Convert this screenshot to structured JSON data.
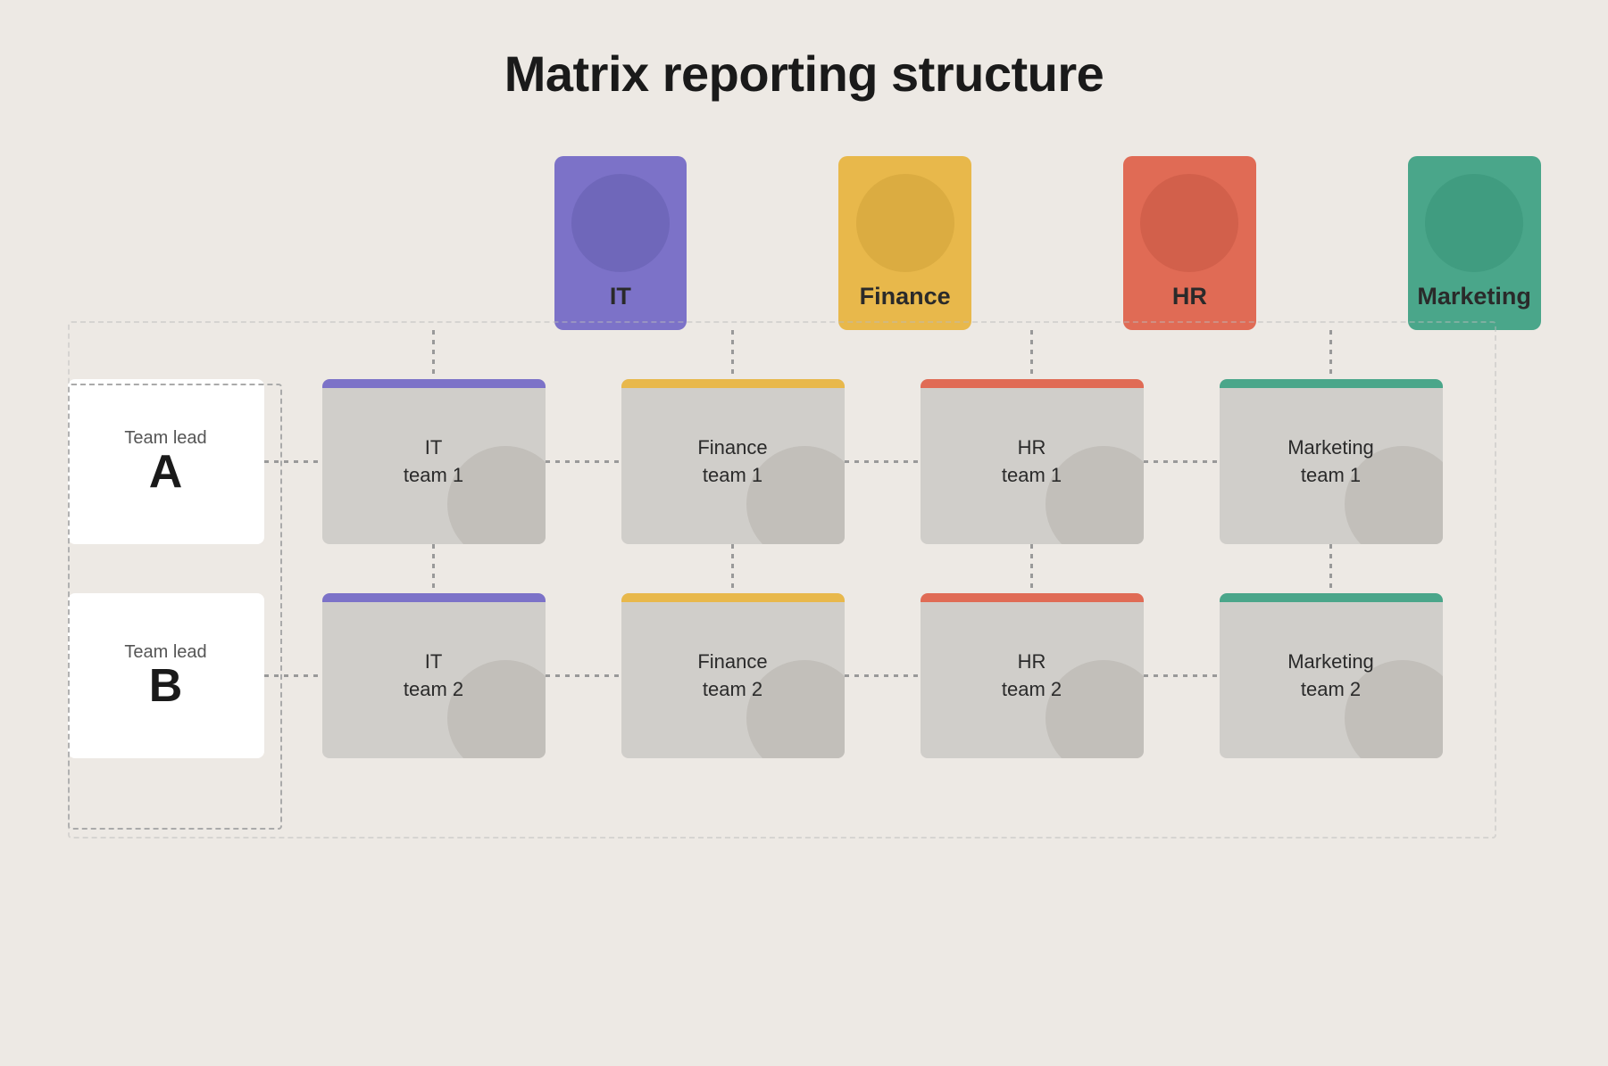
{
  "title": "Matrix reporting structure",
  "departments": [
    {
      "id": "it",
      "label": "IT",
      "colorClass": "dept-it",
      "barClass": "bar-it"
    },
    {
      "id": "finance",
      "label": "Finance",
      "colorClass": "dept-finance",
      "barClass": "bar-finance"
    },
    {
      "id": "hr",
      "label": "HR",
      "colorClass": "dept-hr",
      "barClass": "bar-hr"
    },
    {
      "id": "marketing",
      "label": "Marketing",
      "colorClass": "dept-marketing",
      "barClass": "bar-marketing"
    }
  ],
  "team_leads": [
    {
      "id": "a",
      "title": "Team lead",
      "letter": "A"
    },
    {
      "id": "b",
      "title": "Team lead",
      "letter": "B"
    }
  ],
  "teams_row1": [
    {
      "label": "IT\nteam 1",
      "line1": "IT",
      "line2": "team 1",
      "barClass": "bar-it"
    },
    {
      "label": "Finance\nteam 1",
      "line1": "Finance",
      "line2": "team 1",
      "barClass": "bar-finance"
    },
    {
      "label": "HR\nteam 1",
      "line1": "HR",
      "line2": "team 1",
      "barClass": "bar-hr"
    },
    {
      "label": "Marketing\nteam 1",
      "line1": "Marketing",
      "line2": "team 1",
      "barClass": "bar-marketing"
    }
  ],
  "teams_row2": [
    {
      "label": "IT\nteam 2",
      "line1": "IT",
      "line2": "team 2",
      "barClass": "bar-it"
    },
    {
      "label": "Finance\nteam 2",
      "line1": "Finance",
      "line2": "team 2",
      "barClass": "bar-finance"
    },
    {
      "label": "HR\nteam 2",
      "line1": "HR",
      "line2": "team 2",
      "barClass": "bar-hr"
    },
    {
      "label": "Marketing\nteam 2",
      "line1": "Marketing",
      "line2": "team 2",
      "barClass": "bar-marketing"
    }
  ]
}
